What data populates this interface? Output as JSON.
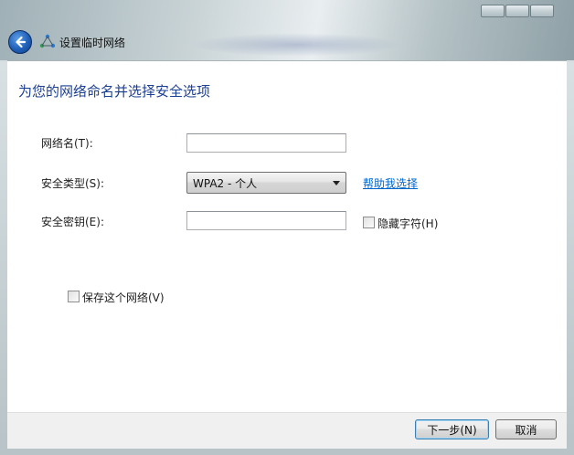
{
  "window": {
    "title": "设置临时网络",
    "caption_buttons": [
      "minimize",
      "maximize",
      "close"
    ]
  },
  "page": {
    "heading": "为您的网络命名并选择安全选项"
  },
  "form": {
    "network_name_label": "网络名(T):",
    "network_name_value": "",
    "security_type_label": "安全类型(S):",
    "security_type_value": "WPA2 - 个人",
    "help_link": "帮助我选择",
    "security_key_label": "安全密钥(E):",
    "security_key_value": "",
    "hide_chars_label": "隐藏字符(H)",
    "hide_chars_checked": false,
    "save_network_label": "保存这个网络(V)",
    "save_network_checked": false
  },
  "footer": {
    "next_label": "下一步(N)",
    "cancel_label": "取消"
  },
  "colors": {
    "heading": "#1b3f91",
    "link": "#0066cc",
    "default_button_border": "#3c7fb1"
  }
}
